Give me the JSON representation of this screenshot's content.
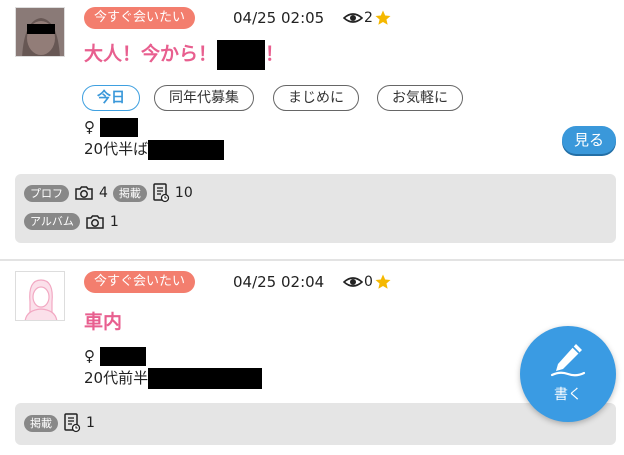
{
  "posts": [
    {
      "tag": "今すぐ会いたい",
      "timestamp": "04/25 02:05",
      "views": "2",
      "title_start": "大人！今から！",
      "title_end": "！",
      "chips": [
        "今日",
        "同年代募集",
        "まじめに",
        "お気軽に"
      ],
      "gender_symbol": "♀",
      "age_text": "20代半ば",
      "view_button": "見る",
      "meta": {
        "profile_label": "プロフ",
        "profile_photo_count": "4",
        "posting_label": "掲載",
        "posting_count": "10",
        "album_label": "アルバム",
        "album_photo_count": "1"
      }
    },
    {
      "tag": "今すぐ会いたい",
      "timestamp": "04/25 02:04",
      "views": "0",
      "title_start": "車内",
      "gender_symbol": "♀",
      "age_text": "20代前半",
      "meta": {
        "posting_label": "掲載",
        "posting_count": "1"
      }
    }
  ],
  "fab": {
    "label": "書く"
  },
  "colors": {
    "accent_blue": "#3a98da",
    "tag_orange": "#f37e6e",
    "title_pink": "#e85f8f"
  }
}
